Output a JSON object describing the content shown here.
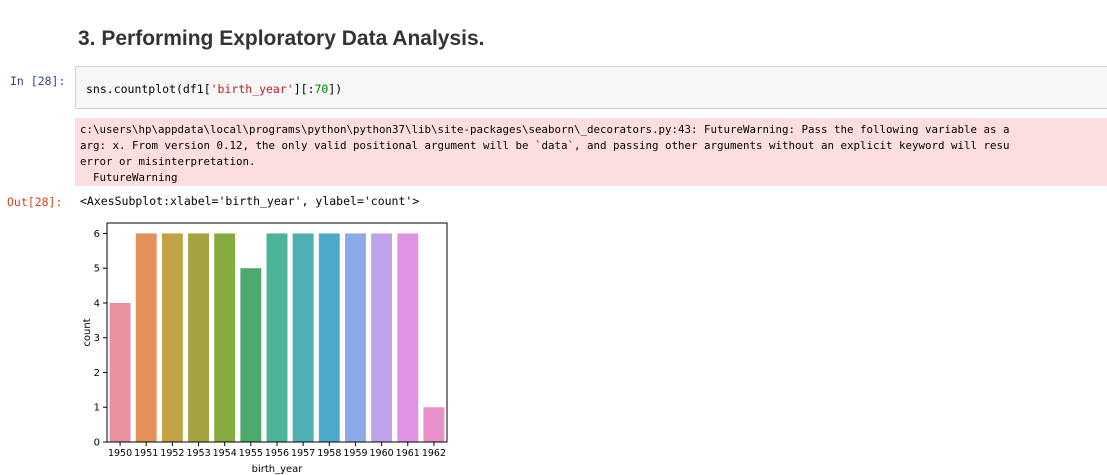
{
  "cell": {
    "heading": "3. Performing Exploratory Data Analysis.",
    "in_prompt": "In [28]:",
    "out_prompt": "Out[28]:",
    "code": {
      "prefix": "sns.countplot(df1[",
      "string": "'birth_year'",
      "middle": "][:",
      "number": "70",
      "suffix": "])"
    },
    "stderr_lines": [
      "c:\\users\\hp\\appdata\\local\\programs\\python\\python37\\lib\\site-packages\\seaborn\\_decorators.py:43: FutureWarning: Pass the following variable as a",
      "arg: x. From version 0.12, the only valid positional argument will be `data`, and passing other arguments without an explicit keyword will resu",
      "error or misinterpretation.",
      "  FutureWarning"
    ],
    "result": "<AxesSubplot:xlabel='birth_year', ylabel='count'>"
  },
  "chart_data": {
    "type": "bar",
    "categories": [
      "1950",
      "1951",
      "1952",
      "1953",
      "1954",
      "1955",
      "1956",
      "1957",
      "1958",
      "1959",
      "1960",
      "1961",
      "1962"
    ],
    "values": [
      4,
      6,
      6,
      6,
      6,
      5,
      6,
      6,
      6,
      6,
      6,
      6,
      1
    ],
    "colors": [
      "#e8919f",
      "#e3905a",
      "#c1a247",
      "#a4a340",
      "#86ab3f",
      "#4daa6f",
      "#4db499",
      "#4db0b2",
      "#4cabc8",
      "#8aaae8",
      "#c0a2ea",
      "#e092e4",
      "#e890ca"
    ],
    "xlabel": "birth_year",
    "ylabel": "count",
    "ylim": [
      0,
      6.3
    ],
    "yticks": [
      0,
      1,
      2,
      3,
      4,
      5,
      6
    ],
    "grid": false
  }
}
